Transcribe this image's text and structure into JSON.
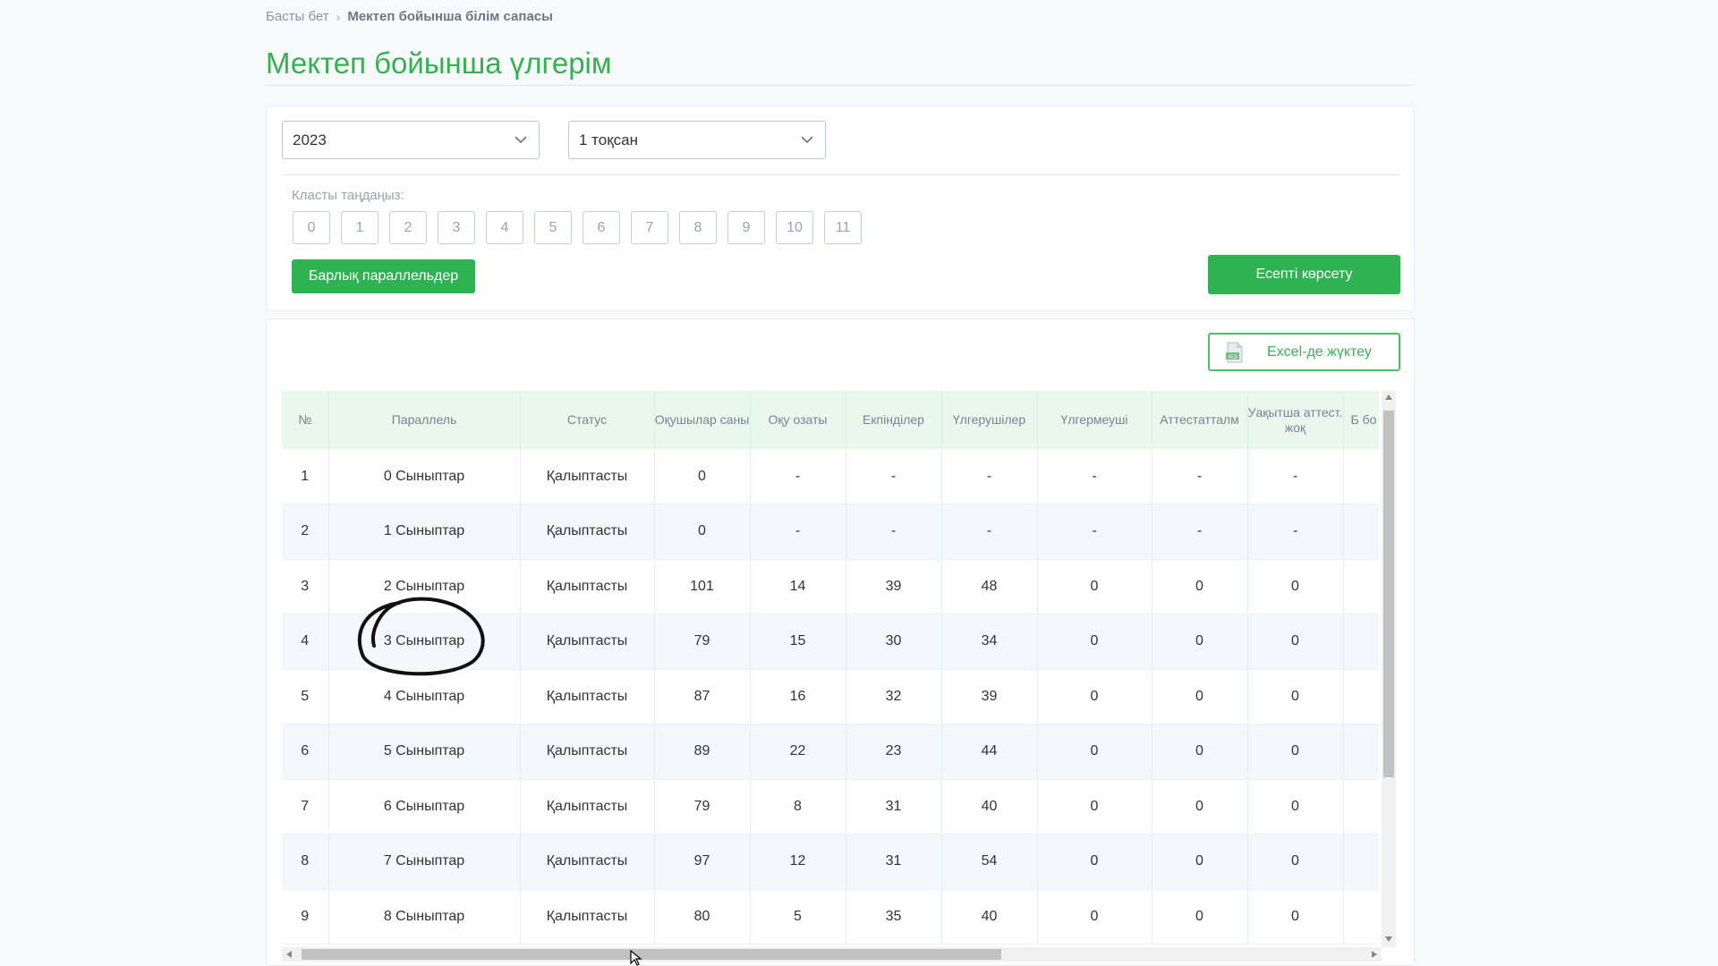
{
  "breadcrumb": {
    "home": "Басты бет",
    "separator": "›",
    "current": "Мектеп бойынша білім сапасы"
  },
  "page_title": "Мектеп бойынша үлгерім",
  "filters": {
    "year": "2023",
    "quarter": "1 тоқсан",
    "class_label": "Класты таңдаңыз:",
    "classes": [
      "0",
      "1",
      "2",
      "3",
      "4",
      "5",
      "6",
      "7",
      "8",
      "9",
      "10",
      "11"
    ],
    "all_parallels_label": "Барлық параллельдер",
    "show_report_label": "Есепті көрсету"
  },
  "table_section": {
    "excel_label": "Excel-де жүктеу",
    "excel_icon": "xls-file-icon",
    "columns": [
      "№",
      "Параллель",
      "Статус",
      "Оқушылар саны",
      "Оқу озаты",
      "Екпінділер",
      "Үлгерушілер",
      "Үлгермеуші",
      "Аттестатталм",
      "Уақытша аттест. жоқ",
      "Б бо"
    ],
    "rows": [
      [
        "1",
        "0 Сыныптар",
        "Қалыптасты",
        "0",
        "-",
        "-",
        "-",
        "-",
        "-",
        "-",
        ""
      ],
      [
        "2",
        "1 Сыныптар",
        "Қалыптасты",
        "0",
        "-",
        "-",
        "-",
        "-",
        "-",
        "-",
        ""
      ],
      [
        "3",
        "2 Сыныптар",
        "Қалыптасты",
        "101",
        "14",
        "39",
        "48",
        "0",
        "0",
        "0",
        ""
      ],
      [
        "4",
        "3 Сыныптар",
        "Қалыптасты",
        "79",
        "15",
        "30",
        "34",
        "0",
        "0",
        "0",
        ""
      ],
      [
        "5",
        "4 Сыныптар",
        "Қалыптасты",
        "87",
        "16",
        "32",
        "39",
        "0",
        "0",
        "0",
        ""
      ],
      [
        "6",
        "5 Сыныптар",
        "Қалыптасты",
        "89",
        "22",
        "23",
        "44",
        "0",
        "0",
        "0",
        ""
      ],
      [
        "7",
        "6 Сыныптар",
        "Қалыптасты",
        "79",
        "8",
        "31",
        "40",
        "0",
        "0",
        "0",
        ""
      ],
      [
        "8",
        "7 Сыныптар",
        "Қалыптасты",
        "97",
        "12",
        "31",
        "54",
        "0",
        "0",
        "0",
        ""
      ],
      [
        "9",
        "8 Сыныптар",
        "Қалыптасты",
        "80",
        "5",
        "35",
        "40",
        "0",
        "0",
        "0",
        ""
      ]
    ]
  },
  "colors": {
    "accent": "#2fb352",
    "header_bg": "#e8f8ec",
    "title": "#35b052"
  }
}
